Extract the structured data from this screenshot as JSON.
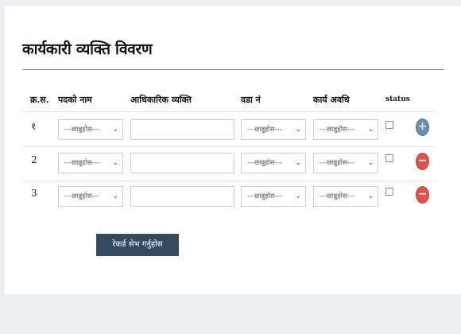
{
  "form": {
    "title": "कार्यकारी व्यक्ति विवरण",
    "columns": {
      "sn": "क्र.स.",
      "position": "पदको नाम",
      "official": "आधिकारिक व्यक्ति",
      "ward": "वडा नं",
      "term": "कार्य अवधि",
      "status": "status"
    },
    "select_placeholder": "---छान्नुहोस---",
    "rows": [
      {
        "sn": "१",
        "action": "add",
        "action_symbol": "+"
      },
      {
        "sn": "2",
        "action": "remove",
        "action_symbol": "−"
      },
      {
        "sn": "3",
        "action": "remove",
        "action_symbol": "−"
      }
    ],
    "save_label": "रेकर्ड सेभ गर्नुहोस"
  },
  "colors": {
    "add_button": "#6d8da8",
    "remove_button": "#d9534f",
    "save_button": "#34495e"
  }
}
